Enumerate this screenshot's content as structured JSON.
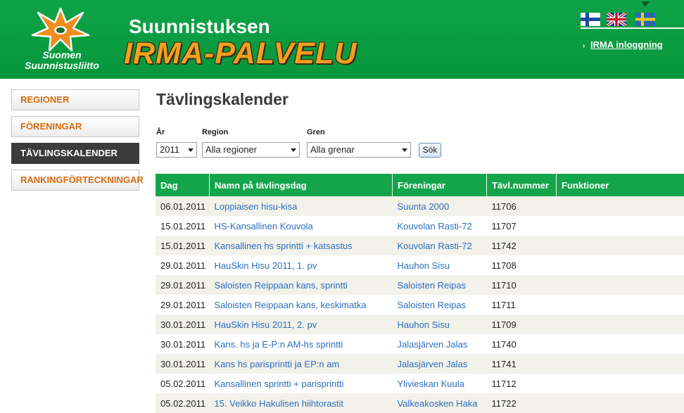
{
  "header": {
    "logo_line1": "Suomen",
    "logo_line2": "Suunnistusliitto",
    "title_small": "Suunnistuksen",
    "title_big": "IRMA-PALVELU",
    "login_link": "IRMA inloggning",
    "flags": [
      "finnish-flag",
      "uk-flag",
      "swedish-flag"
    ]
  },
  "sidebar": {
    "items": [
      {
        "label": "REGIONER"
      },
      {
        "label": "FÖRENINGAR"
      },
      {
        "label": "TÄVLINGSKALENDER"
      },
      {
        "label": "RANKINGFÖRTECKNINGAR"
      }
    ],
    "active_index": 2
  },
  "main": {
    "title": "Tävlingskalender",
    "filters": {
      "year_label": "År",
      "year_value": "2011",
      "region_label": "Region",
      "region_value": "Alla regioner",
      "gren_label": "Gren",
      "gren_value": "Alla grenar",
      "search_button": "Sök"
    },
    "table": {
      "columns": [
        "Dag",
        "Namn på tävlingsdag",
        "Föreningar",
        "Tävl.nummer",
        "Funktioner"
      ],
      "rows": [
        [
          "06.01.2011",
          "Loppiaisen hisu-kisa",
          "Suunta 2000",
          "11706"
        ],
        [
          "15.01.2011",
          "HS-Kansallinen Kouvola",
          "Kouvolan Rasti-72",
          "11707"
        ],
        [
          "15.01.2011",
          "Kansallinen hs sprintti + katsastus",
          "Kouvolan Rasti-72",
          "11742"
        ],
        [
          "29.01.2011",
          "HauSkin Hisu 2011, 1. pv",
          "Hauhon Sisu",
          "11708"
        ],
        [
          "29.01.2011",
          "Saloisten Reippaan kans, sprintti",
          "Saloisten Reipas",
          "11710"
        ],
        [
          "29.01.2011",
          "Saloisten Reippaan kans, keskimatka",
          "Saloisten Reipas",
          "11711"
        ],
        [
          "30.01.2011",
          "HauSkin Hisu 2011, 2. pv",
          "Hauhon Sisu",
          "11709"
        ],
        [
          "30.01.2011",
          "Kans. hs ja E-P:n AM-hs sprintti",
          "Jalasjärven Jalas",
          "11740"
        ],
        [
          "30.01.2011",
          "Kans hs parisprintti ja EP:n am",
          "Jalasjärven Jalas",
          "11741"
        ],
        [
          "05.02.2011",
          "Kansallinen sprintti + parisprintti",
          "Ylivieskan Kuula",
          "11712"
        ],
        [
          "05.02.2011",
          "15. Veikko Hakulisen hiihtorastit",
          "Valkeakosken Haka",
          "11722"
        ]
      ]
    }
  },
  "colors": {
    "header_green": "#0fa347",
    "table_header_green": "#14a54a",
    "nav_orange": "#d96c0f",
    "link_blue": "#2c6fbe",
    "title_orange": "#f4a020"
  }
}
